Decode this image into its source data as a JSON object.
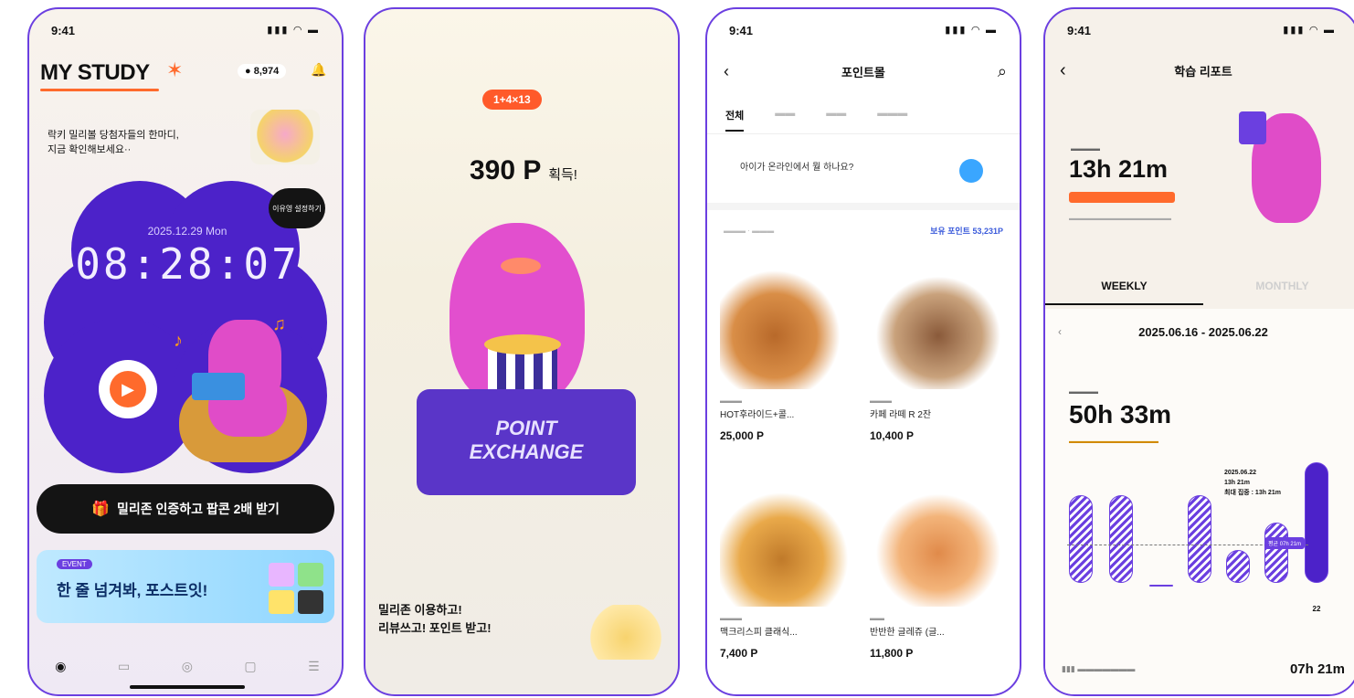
{
  "status_time": "9:41",
  "status_icons": "▮▮▮ ◠ ▬",
  "screen1": {
    "title": "MY STUDY",
    "points": "8,974",
    "notice": "락키 밀리볼 당첨자들의 한마디,\n지금 확인해보세요··",
    "date": "2025.12.29 Mon",
    "clock": "08:28:07",
    "alarm_setting": "이유영 설정하기",
    "cta_label": "밀리존 인증하고 팝콘 2배 받기",
    "banner_text": "한 줄 넘겨봐, 포스트잇!"
  },
  "screen2": {
    "points_value": "390 P",
    "points_suffix": "획득!",
    "box_line1": "POINT",
    "box_line2": "EXCHANGE",
    "footer_line1": "밀리존 이용하고!",
    "footer_line2": "리뷰쓰고! 포인트 받고!"
  },
  "screen3": {
    "title": "포인트몰",
    "tab_active": "전체",
    "question": "아이가 온라인에서 뭘 하나요?",
    "owned_points": "보유 포인트 53,231P",
    "products": [
      {
        "name": "HOT후라이드+콜...",
        "price": "25,000 P"
      },
      {
        "name": "카페 라떼 R 2잔",
        "price": "10,400 P"
      },
      {
        "name": "맥크리스피 클래식...",
        "price": "7,400 P"
      },
      {
        "name": "반반한 글레쥬 (글...",
        "price": "11,800 P"
      }
    ]
  },
  "screen4": {
    "title": "학습 리포트",
    "today_value": "13h 21m",
    "tab_weekly": "WEEKLY",
    "tab_monthly": "MONTHLY",
    "range": "2025.06.16 - 2025.06.22",
    "week_value": "50h 33m",
    "tooltip_line1": "2025.06.22",
    "tooltip_line2": "13h 21m",
    "tooltip_line3": "최대 집중 : 13h 21m",
    "avg_tag": "평균 07h 21m",
    "selected_day": "22",
    "bottom_value": "07h 21m"
  }
}
